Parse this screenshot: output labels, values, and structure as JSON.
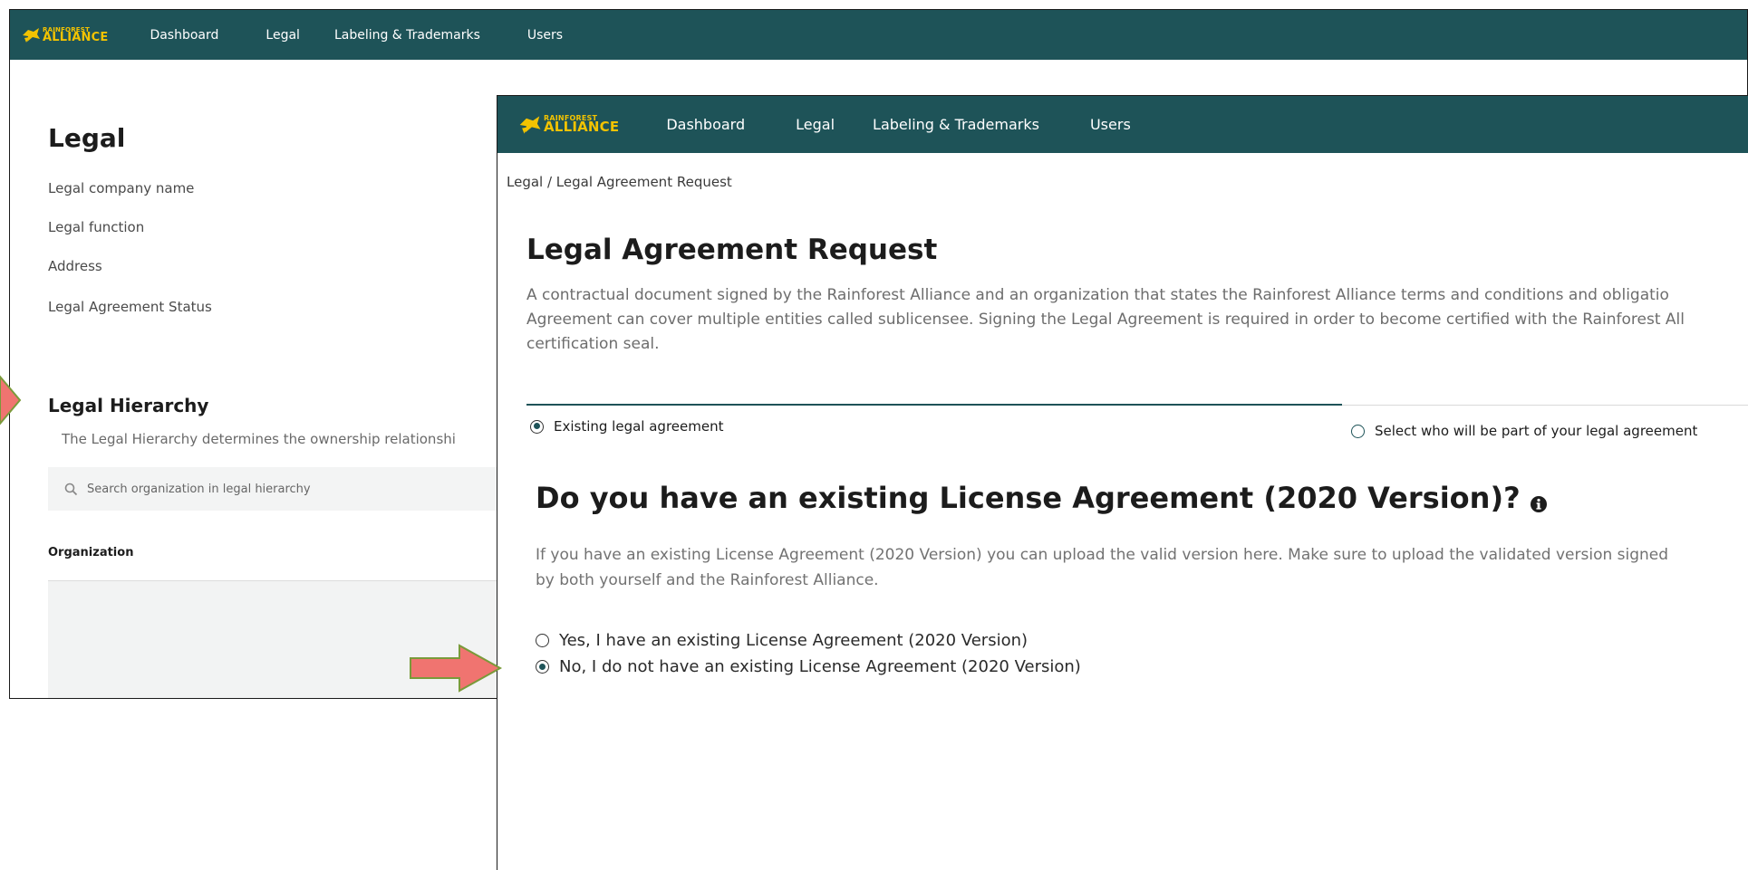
{
  "back_window": {
    "nav": {
      "logo_line1": "RAINFOREST",
      "logo_line2": "ALLIANCE",
      "items": [
        "Dashboard",
        "Legal",
        "Labeling & Trademarks",
        "Users"
      ]
    },
    "page_title": "Legal",
    "fields": [
      "Legal company name",
      "Legal function",
      "Address",
      "Legal Agreement Status"
    ],
    "hierarchy_title": "Legal Hierarchy",
    "hierarchy_desc": "The Legal Hierarchy determines the ownership relationshi",
    "search_placeholder": "Search organization in legal hierarchy",
    "column_header": "Organization"
  },
  "front_window": {
    "nav": {
      "logo_line1": "RAINFOREST",
      "logo_line2": "ALLIANCE",
      "items": [
        "Dashboard",
        "Legal",
        "Labeling & Trademarks",
        "Users"
      ]
    },
    "breadcrumb": "Legal / Legal Agreement Request",
    "page_title": "Legal Agreement Request",
    "description_lines": [
      "A contractual document signed by the Rainforest Alliance and an organization that states the Rainforest Alliance terms and conditions and obligatio",
      "Agreement can cover multiple entities called sublicensee. Signing the Legal Agreement is required in order to become certified with the Rainforest All",
      "certification seal."
    ],
    "tabs": [
      {
        "label": "Existing legal agreement",
        "selected": true
      },
      {
        "label": "Select who will be part of your legal agreement",
        "selected": false
      }
    ],
    "question": "Do you have an existing License Agreement  (2020 Version)?",
    "help_lines": [
      "If you have an existing License Agreement (2020 Version) you can upload the valid version here. Make sure to upload the validated version signed",
      "by both yourself and the Rainforest Alliance."
    ],
    "options": [
      {
        "label": "Yes, I have an existing License Agreement (2020 Version)",
        "selected": false
      },
      {
        "label": "No, I do not have an existing License Agreement (2020 Version)",
        "selected": true
      }
    ]
  },
  "colors": {
    "nav_bg": "#1e5358",
    "logo_yellow": "#f3c300",
    "arrow_fill": "#f07470",
    "arrow_stroke": "#7a9a3a"
  },
  "icons": [
    "frog-logo-icon",
    "search-icon",
    "info-icon",
    "arrow-pointer-icon"
  ]
}
